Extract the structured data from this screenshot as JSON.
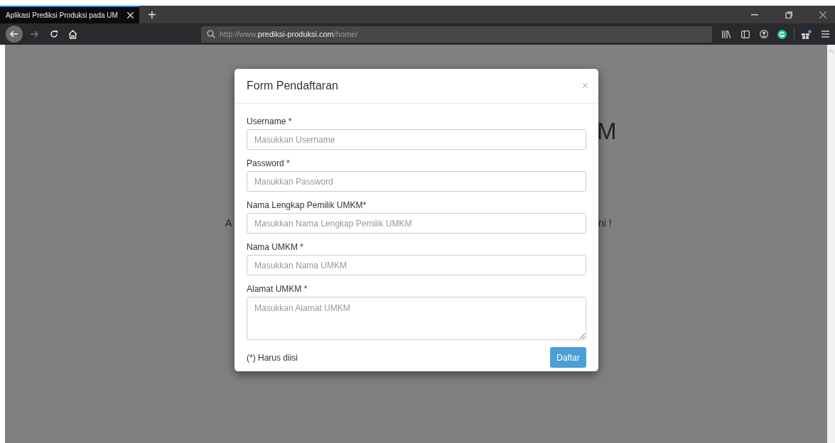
{
  "browser": {
    "tab": {
      "title": "Aplikasi Prediksi Produksi pada UM",
      "selected": true
    },
    "new_tab": "+",
    "url": {
      "prefix": "http://www.",
      "domain": "prediksi-produksi.com",
      "path": "/home/"
    }
  },
  "background_page": {
    "heading_fragment": "M",
    "text_fragment_left": "A",
    "text_fragment_right": "ni !"
  },
  "modal": {
    "title": "Form Pendaftaran",
    "close": "×",
    "fields": [
      {
        "kind": "input",
        "label": "Username *",
        "placeholder": "Masukkan Username"
      },
      {
        "kind": "input",
        "label": "Password *",
        "placeholder": "Masukkan Password"
      },
      {
        "kind": "input",
        "label": "Nama Lengkap Pemilik UMKM*",
        "placeholder": "Masukkan Nama Lengkap Pemilik UMKM"
      },
      {
        "kind": "input",
        "label": "Nama UMKM *",
        "placeholder": "Masukkan Nama UMKM"
      },
      {
        "kind": "textarea",
        "label": "Alamat UMKM *",
        "placeholder": "Masukkan Alamat UMKM"
      }
    ],
    "note": "(*) Harus diisi",
    "submit_button": "Daftar"
  }
}
